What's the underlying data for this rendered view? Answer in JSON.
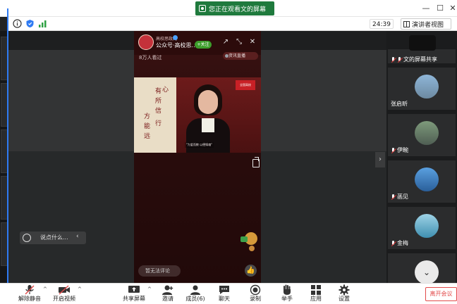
{
  "colors": {
    "accent": "#2f7bf3",
    "share_green": "#1f7a3d",
    "follow_green": "#3d9d2b",
    "danger": "#e24a4a"
  },
  "titlebar": {
    "share_notice": "您正在观看文的屏幕",
    "min_icon": "minimize-icon",
    "max_icon": "maximize-icon",
    "close_icon": "close-icon"
  },
  "infobar": {
    "timer": "24:39",
    "view_mode": "演讲者视图"
  },
  "video": {
    "account_line1": "高校思政网",
    "account_line2": "公众号·高校思...",
    "follow": "+关注",
    "viewers": "8万人看过",
    "live_tag": "资讯直播",
    "banner": "全国高校",
    "calligraphy": [
      "心",
      "有",
      "所",
      "信",
      "方",
      "能",
      "行",
      "远"
    ],
    "caption": "\"为爱而教 以德铸魂\"",
    "comment_placeholder": "暂无法评论"
  },
  "chat": {
    "placeholder": "说点什么..."
  },
  "participants": {
    "owner": {
      "name": "文的屏幕共享"
    },
    "tiles": [
      {
        "name": "张启昕",
        "muted": false
      },
      {
        "name": "伊畹",
        "muted": true
      },
      {
        "name": "菡见",
        "muted": true
      },
      {
        "name": "金梅",
        "muted": true
      }
    ]
  },
  "toolbar": {
    "items": [
      {
        "label": "解除静音",
        "icon": "mic-muted-icon"
      },
      {
        "label": "开启视频",
        "icon": "video-off-icon"
      },
      {
        "label": "共享屏幕",
        "icon": "share-screen-icon"
      },
      {
        "label": "邀请",
        "icon": "invite-icon"
      },
      {
        "label": "成员(6)",
        "icon": "members-icon"
      },
      {
        "label": "聊天",
        "icon": "chat-icon"
      },
      {
        "label": "录制",
        "icon": "record-icon"
      },
      {
        "label": "举手",
        "icon": "raise-hand-icon"
      },
      {
        "label": "应用",
        "icon": "apps-icon"
      },
      {
        "label": "设置",
        "icon": "settings-icon"
      }
    ],
    "leave": "离开会议"
  }
}
